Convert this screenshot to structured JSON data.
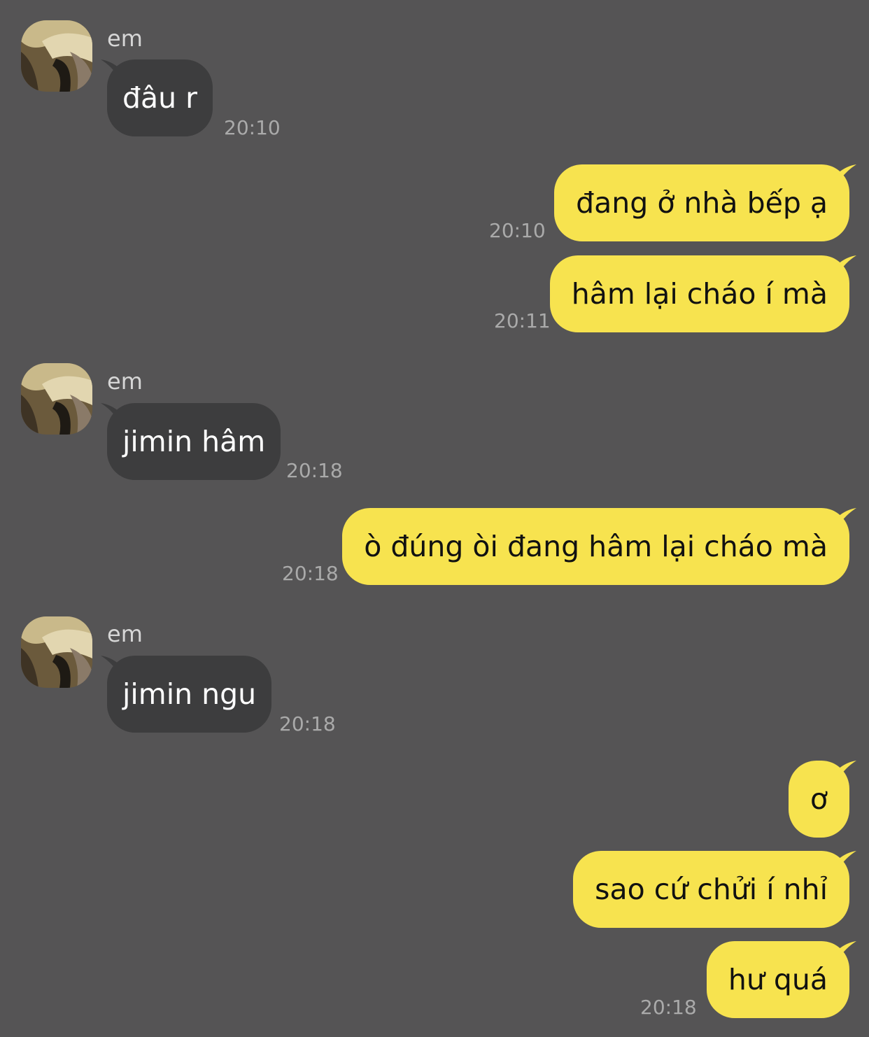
{
  "colors": {
    "background": "#555455",
    "incoming_bubble": "#3d3d3e",
    "outgoing_bubble": "#f7e34f",
    "timestamp": "#aaaaaa",
    "sender_name": "#d6d6d6"
  },
  "groups": [
    {
      "direction": "incoming",
      "sender": "em",
      "messages": [
        {
          "text": "đâu r",
          "time": "20:10"
        }
      ]
    },
    {
      "direction": "outgoing",
      "messages": [
        {
          "text": "đang ở nhà bếp ạ",
          "time": "20:10"
        },
        {
          "text": "hâm lại cháo í mà",
          "time": "20:11"
        }
      ]
    },
    {
      "direction": "incoming",
      "sender": "em",
      "messages": [
        {
          "text": "jimin hâm",
          "time": "20:18"
        }
      ]
    },
    {
      "direction": "outgoing",
      "messages": [
        {
          "text": "ò đúng òi đang hâm lại cháo mà",
          "time": "20:18"
        }
      ]
    },
    {
      "direction": "incoming",
      "sender": "em",
      "messages": [
        {
          "text": "jimin ngu",
          "time": "20:18"
        }
      ]
    },
    {
      "direction": "outgoing",
      "messages": [
        {
          "text": "ơ"
        },
        {
          "text": "sao cứ chửi í nhỉ"
        },
        {
          "text": "hư quá",
          "time": "20:18"
        }
      ]
    }
  ]
}
